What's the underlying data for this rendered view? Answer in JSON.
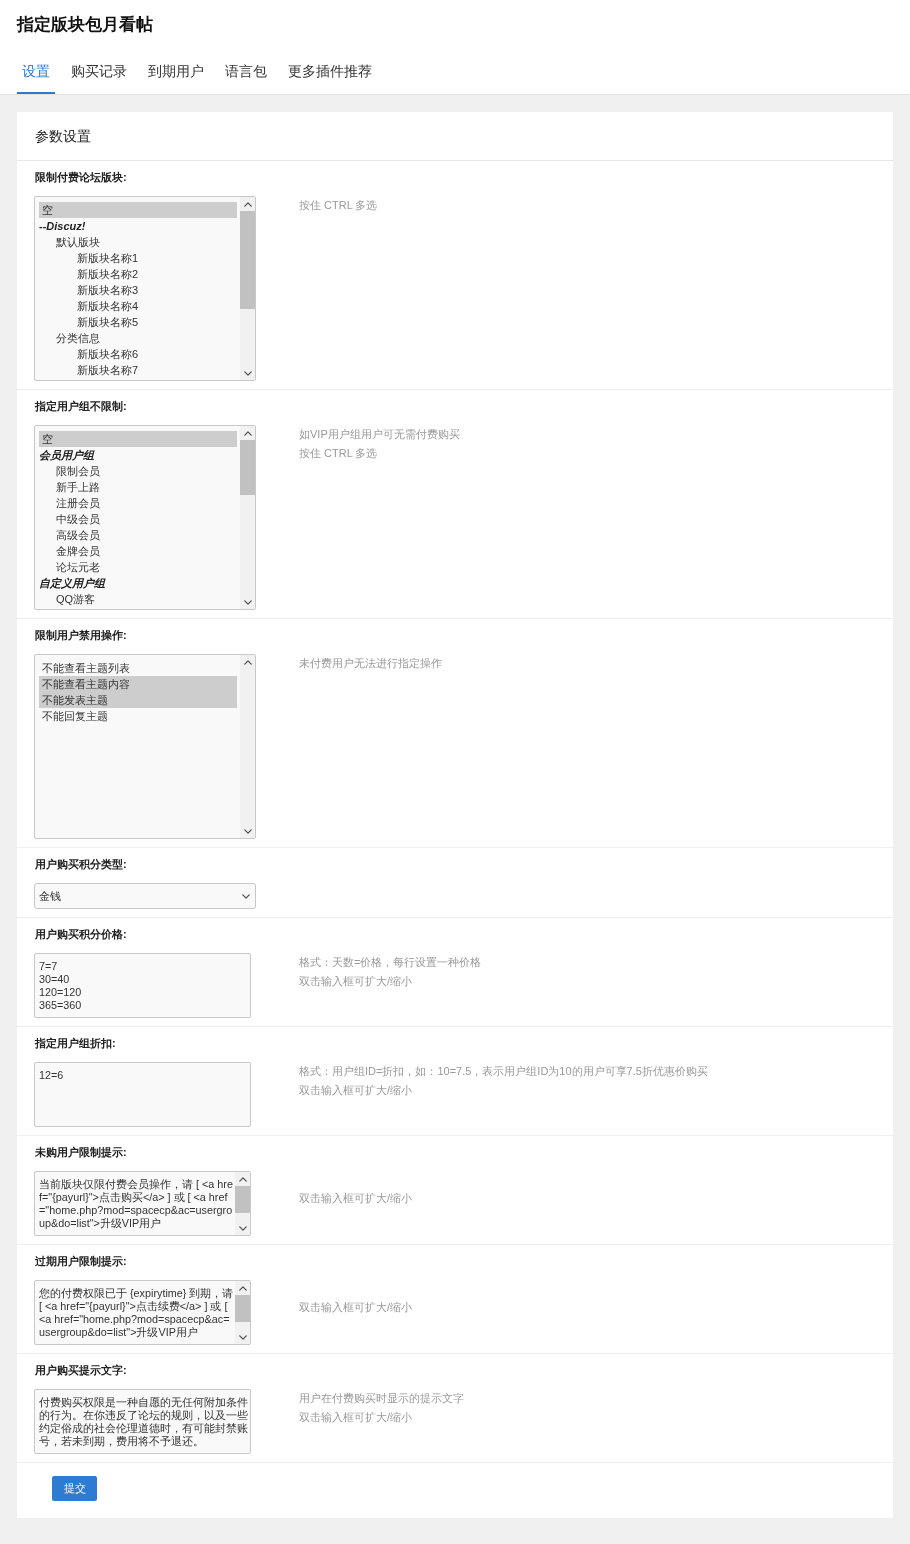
{
  "page": {
    "title": "指定版块包月看帖"
  },
  "tabs": [
    {
      "label": "设置",
      "selected": true
    },
    {
      "label": "购买记录",
      "selected": false
    },
    {
      "label": "到期用户",
      "selected": false
    },
    {
      "label": "语言包",
      "selected": false
    },
    {
      "label": "更多插件推荐",
      "selected": false
    }
  ],
  "panel": {
    "title": "参数设置",
    "settings": [
      {
        "kind": "listbox",
        "label": "限制付费论坛版块:",
        "options": [
          {
            "kind": "option",
            "label": "空",
            "selected": true
          },
          {
            "kind": "group",
            "label": "--Discuz!",
            "children": [
              {
                "kind": "option",
                "label": "默认版块",
                "selected": false,
                "children": [
                  {
                    "kind": "option",
                    "label": "新版块名称1",
                    "selected": false
                  },
                  {
                    "kind": "option",
                    "label": "新版块名称2",
                    "selected": false
                  },
                  {
                    "kind": "option",
                    "label": "新版块名称3",
                    "selected": false
                  },
                  {
                    "kind": "option",
                    "label": "新版块名称4",
                    "selected": false
                  },
                  {
                    "kind": "option",
                    "label": "新版块名称5",
                    "selected": false
                  }
                ]
              },
              {
                "kind": "option",
                "label": "分类信息",
                "selected": false,
                "children": [
                  {
                    "kind": "option",
                    "label": "新版块名称6",
                    "selected": false
                  },
                  {
                    "kind": "option",
                    "label": "新版块名称7",
                    "selected": false
                  }
                ]
              }
            ]
          }
        ],
        "hints": [
          "按住 CTRL 多选"
        ]
      },
      {
        "kind": "listbox",
        "label": "指定用户组不限制:",
        "options": [
          {
            "kind": "option",
            "label": "空",
            "selected": true
          },
          {
            "kind": "group",
            "label": "会员用户组",
            "children": [
              {
                "kind": "option",
                "label": "限制会员",
                "selected": false
              },
              {
                "kind": "option",
                "label": "新手上路",
                "selected": false
              },
              {
                "kind": "option",
                "label": "注册会员",
                "selected": false
              },
              {
                "kind": "option",
                "label": "中级会员",
                "selected": false
              },
              {
                "kind": "option",
                "label": "高级会员",
                "selected": false
              },
              {
                "kind": "option",
                "label": "金牌会员",
                "selected": false
              },
              {
                "kind": "option",
                "label": "论坛元老",
                "selected": false
              }
            ]
          },
          {
            "kind": "group",
            "label": "自定义用户组",
            "children": [
              {
                "kind": "option",
                "label": "QQ游客",
                "selected": false
              }
            ]
          }
        ],
        "hints": [
          "如VIP用户组用户可无需付费购买",
          "按住 CTRL 多选"
        ]
      },
      {
        "kind": "listbox",
        "label": "限制用户禁用操作:",
        "options": [
          {
            "kind": "option",
            "label": "不能查看主题列表",
            "selected": false
          },
          {
            "kind": "option",
            "label": "不能查看主题内容",
            "selected": true
          },
          {
            "kind": "option",
            "label": "不能发表主题",
            "selected": true
          },
          {
            "kind": "option",
            "label": "不能回复主题",
            "selected": false
          }
        ],
        "hints": [
          "未付费用户无法进行指定操作"
        ]
      },
      {
        "kind": "select",
        "label": "用户购买积分类型:",
        "value": "金钱"
      },
      {
        "kind": "textarea",
        "label": "用户购买积分价格:",
        "value": "7=7\n30=40\n120=120\n365=360",
        "hints": [
          "格式：天数=价格，每行设置一种价格",
          "双击输入框可扩大/缩小"
        ]
      },
      {
        "kind": "textarea",
        "label": "指定用户组折扣:",
        "value": "12=6",
        "hints": [
          "格式：用户组ID=折扣，如：10=7.5，表示用户组ID为10的用户可享7.5折优惠价购买",
          "双击输入框可扩大/缩小"
        ]
      },
      {
        "kind": "textarea",
        "label": "未购用户限制提示:",
        "value": "当前版块仅限付费会员操作，请 [ <a href=\"{payurl}\">点击购买</a> ] 或 [ <a href=\"home.php?mod=spacecp&ac=usergroup&do=list\">升级VIP用户",
        "hints": [
          "双击输入框可扩大/缩小"
        ]
      },
      {
        "kind": "textarea",
        "label": "过期用户限制提示:",
        "value": "您的付费权限已于 {expirytime} 到期，请 [ <a href=\"{payurl}\">点击续费</a> ] 或 [ <a href=\"home.php?mod=spacecp&ac=usergroup&do=list\">升级VIP用户",
        "hints": [
          "双击输入框可扩大/缩小"
        ]
      },
      {
        "kind": "textarea",
        "label": "用户购买提示文字:",
        "value": "付费购买权限是一种自愿的无任何附加条件的行为。在你违反了论坛的规则，以及一些约定俗成的社会伦理道德时，有可能封禁账号，若未到期，费用将不予退还。",
        "hints": [
          "用户在付费购买时显示的提示文字",
          "双击输入框可扩大/缩小"
        ]
      }
    ],
    "submit": {
      "label": "提交"
    }
  }
}
